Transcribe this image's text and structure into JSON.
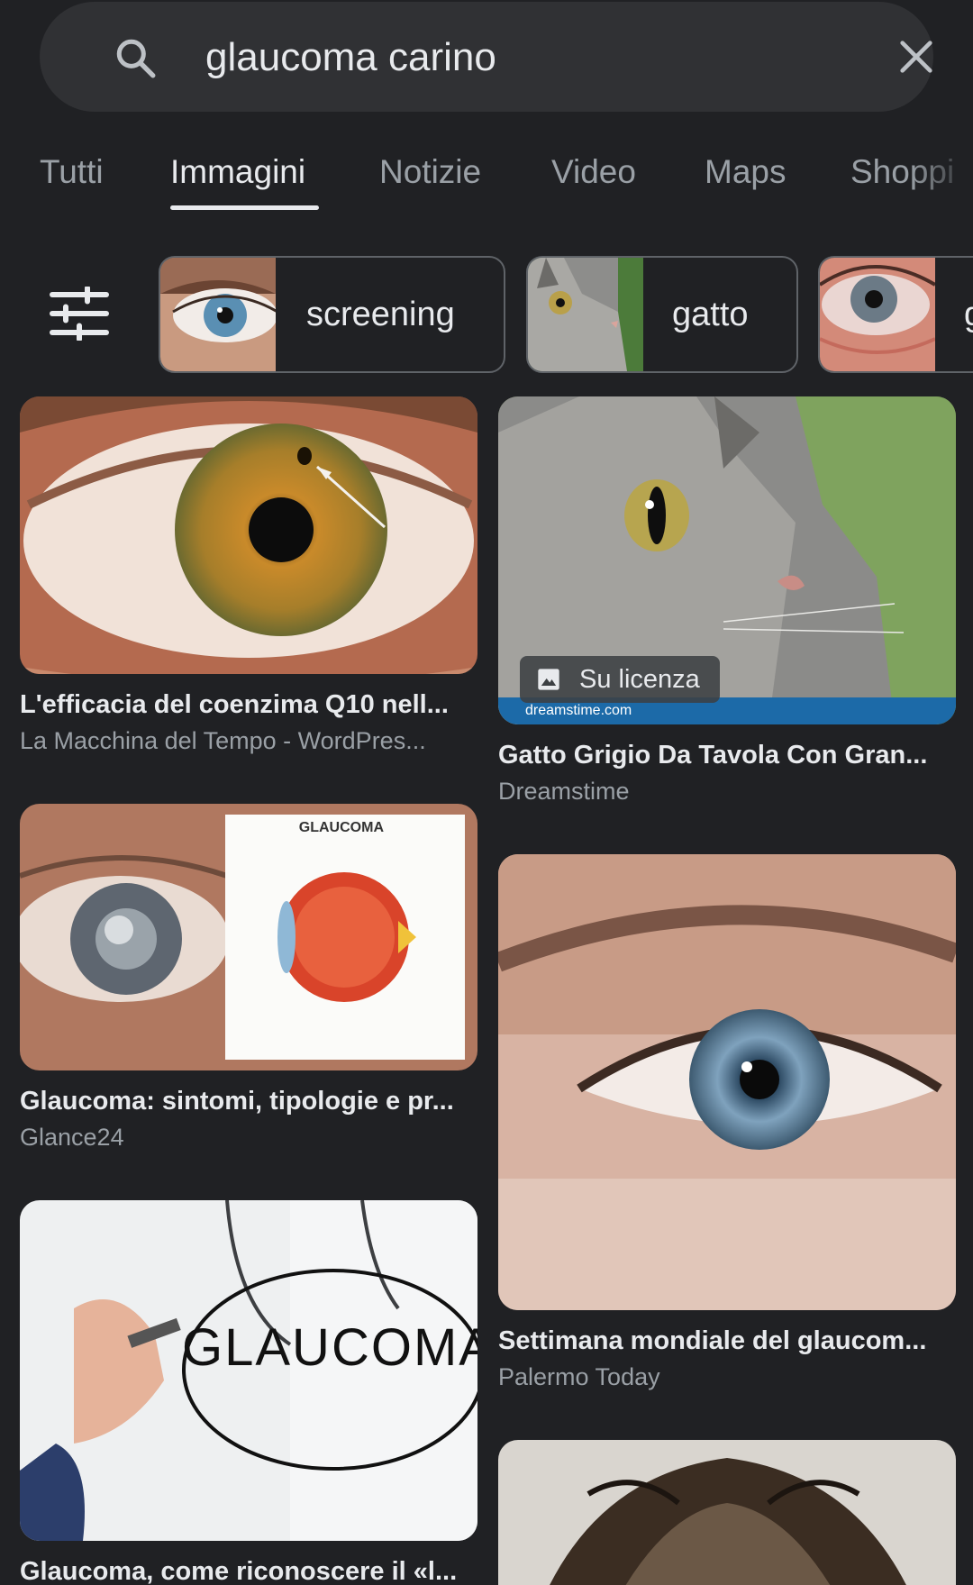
{
  "search": {
    "query": "glaucoma carino"
  },
  "tabs": [
    {
      "label": "Tutti"
    },
    {
      "label": "Immagini"
    },
    {
      "label": "Notizie"
    },
    {
      "label": "Video"
    },
    {
      "label": "Maps"
    },
    {
      "label": "Shoppi"
    }
  ],
  "chips": [
    {
      "label": "screening"
    },
    {
      "label": "gatto"
    },
    {
      "label": "g"
    }
  ],
  "results": [
    {
      "title": "L'efficacia del coenzima Q10 nell...",
      "source": "La Macchina del Tempo - WordPres..."
    },
    {
      "title": "Gatto Grigio Da Tavola Con Gran...",
      "source": "Dreamstime",
      "badge": "Su licenza",
      "watermark": "dreamstime.com"
    },
    {
      "title": "Glaucoma: sintomi, tipologie e pr...",
      "source": "Glance24",
      "diagram_title": "GLAUCOMA"
    },
    {
      "title": "Settimana mondiale del glaucom...",
      "source": "Palermo Today"
    },
    {
      "title": "Glaucoma, come riconoscere il «l...",
      "image_text": "GLAUCOMA"
    }
  ],
  "colors": {
    "background": "#202124",
    "surface": "#303134",
    "text": "#e8eaed",
    "secondary_text": "#9aa0a6",
    "outline": "#5f6368"
  },
  "icons": {
    "search": "search-icon",
    "clear": "close-icon",
    "filter": "tune-icon",
    "badge": "image-icon"
  }
}
